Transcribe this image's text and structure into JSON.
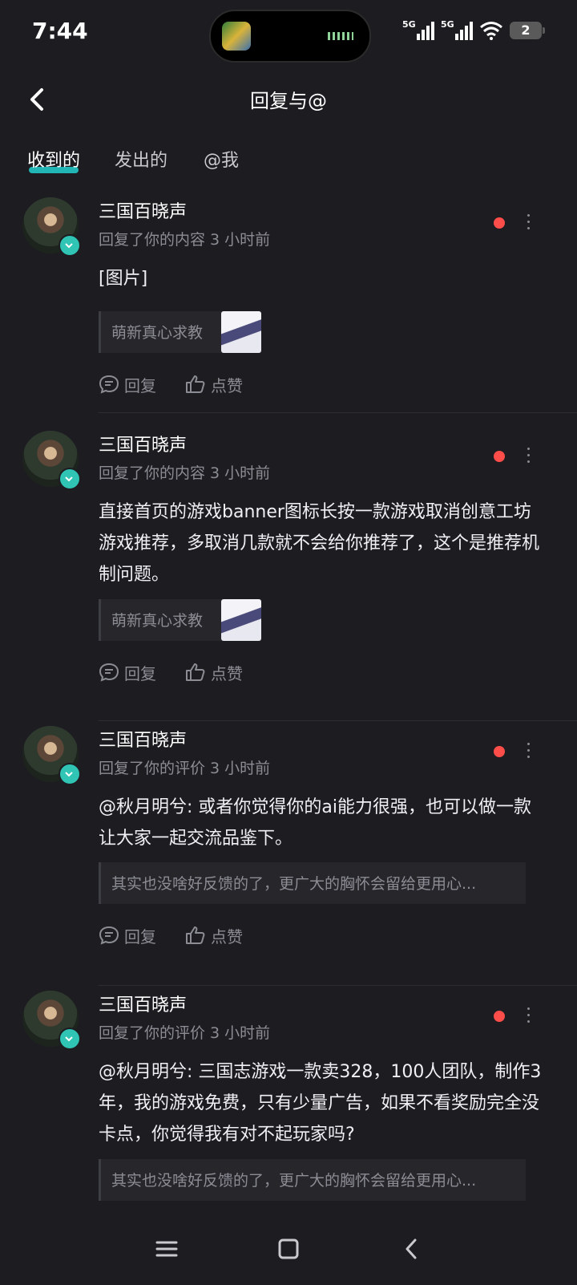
{
  "status": {
    "time": "7:44",
    "network1": "5G",
    "network2": "5G",
    "battery": "2"
  },
  "header": {
    "title": "回复与@"
  },
  "tabs": [
    {
      "label": "收到的"
    },
    {
      "label": "发出的"
    },
    {
      "label": "@我"
    }
  ],
  "items": [
    {
      "name": "三国百晓声",
      "meta": "回复了你的内容 3 小时前",
      "content": "[图片]",
      "quote": "萌新真心求教",
      "reply": "回复",
      "like": "点赞"
    },
    {
      "name": "三国百晓声",
      "meta": "回复了你的内容 3 小时前",
      "content": "直接首页的游戏banner图标长按一款游戏取消创意工坊游戏推荐，多取消几款就不会给你推荐了，这个是推荐机制问题。",
      "quote": "萌新真心求教",
      "reply": "回复",
      "like": "点赞"
    },
    {
      "name": "三国百晓声",
      "meta": "回复了你的评价 3 小时前",
      "content": "@秋月明兮: 或者你觉得你的ai能力很强，也可以做一款让大家一起交流品鉴下。",
      "quote": "其实也没啥好反馈的了，更广大的胸怀会留给更用心...",
      "reply": "回复",
      "like": "点赞"
    },
    {
      "name": "三国百晓声",
      "meta": "回复了你的评价 3 小时前",
      "content": "@秋月明兮: 三国志游戏一款卖328，100人团队，制作3年，我的游戏免费，只有少量广告，如果不看奖励完全没卡点，你觉得我有对不起玩家吗?",
      "quote": "其实也没啥好反馈的了，更广大的胸怀会留给更用心..."
    }
  ]
}
